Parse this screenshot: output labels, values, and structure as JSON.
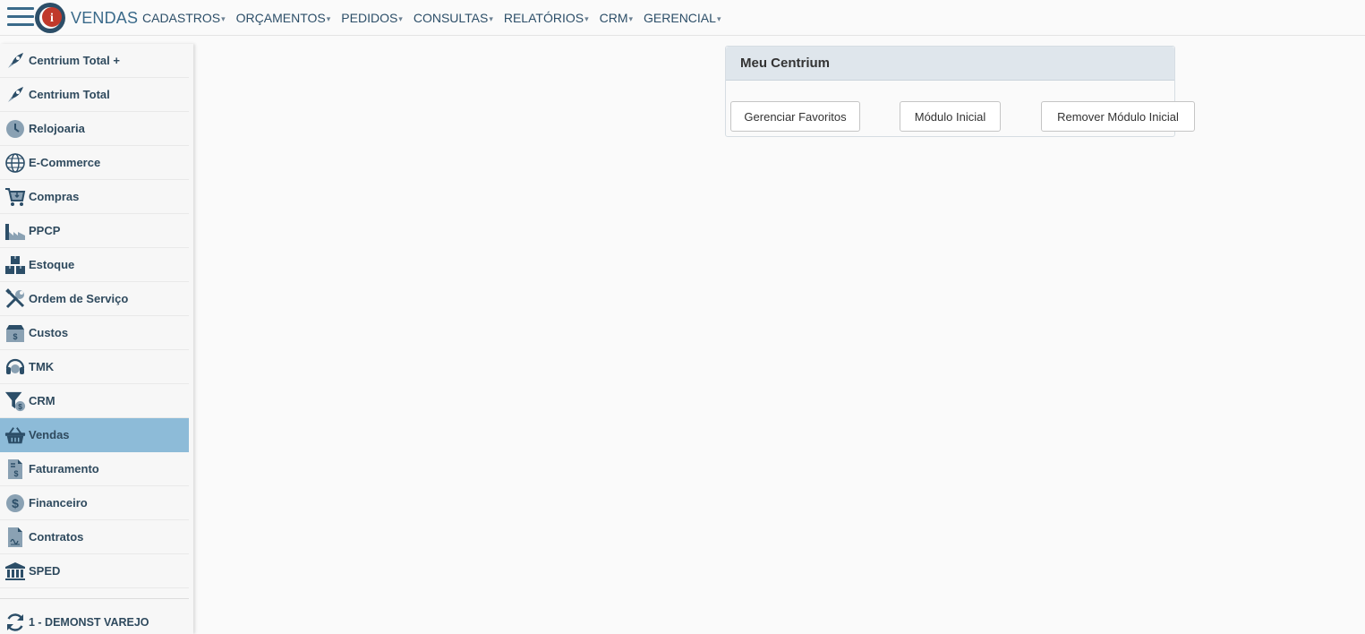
{
  "header": {
    "app_title": "VENDAS",
    "menu": [
      {
        "label": "CADASTROS"
      },
      {
        "label": "ORÇAMENTOS"
      },
      {
        "label": "PEDIDOS"
      },
      {
        "label": "CONSULTAS"
      },
      {
        "label": "RELATÓRIOS"
      },
      {
        "label": "CRM"
      },
      {
        "label": "GERENCIAL"
      }
    ],
    "caret": "▾"
  },
  "sidebar": {
    "items": [
      {
        "label": "Centrium Total +",
        "icon": "rocket-icon"
      },
      {
        "label": "Centrium Total",
        "icon": "rocket-icon"
      },
      {
        "label": "Relojoaria",
        "icon": "clock-icon"
      },
      {
        "label": "E-Commerce",
        "icon": "globe-icon"
      },
      {
        "label": "Compras",
        "icon": "cart-icon"
      },
      {
        "label": "PPCP",
        "icon": "factory-icon"
      },
      {
        "label": "Estoque",
        "icon": "boxes-icon"
      },
      {
        "label": "Ordem de Serviço",
        "icon": "tools-icon"
      },
      {
        "label": "Custos",
        "icon": "money-box-icon"
      },
      {
        "label": "TMK",
        "icon": "headset-icon"
      },
      {
        "label": "CRM",
        "icon": "funnel-icon"
      },
      {
        "label": "Vendas",
        "icon": "basket-icon",
        "active": true
      },
      {
        "label": "Faturamento",
        "icon": "invoice-icon"
      },
      {
        "label": "Financeiro",
        "icon": "dollar-icon"
      },
      {
        "label": "Contratos",
        "icon": "contract-icon"
      },
      {
        "label": "SPED",
        "icon": "bank-icon"
      }
    ],
    "company": "1 - DEMONST VAREJO"
  },
  "panel": {
    "title": "Meu Centrium",
    "buttons": [
      "Gerenciar Favoritos",
      "Módulo Inicial",
      "Remover Módulo Inicial"
    ]
  },
  "colors": {
    "accent": "#3a6a8a",
    "active_item": "#8dbbd8",
    "panel_header": "#dfe6ec",
    "logo_red": "#c0392b"
  }
}
